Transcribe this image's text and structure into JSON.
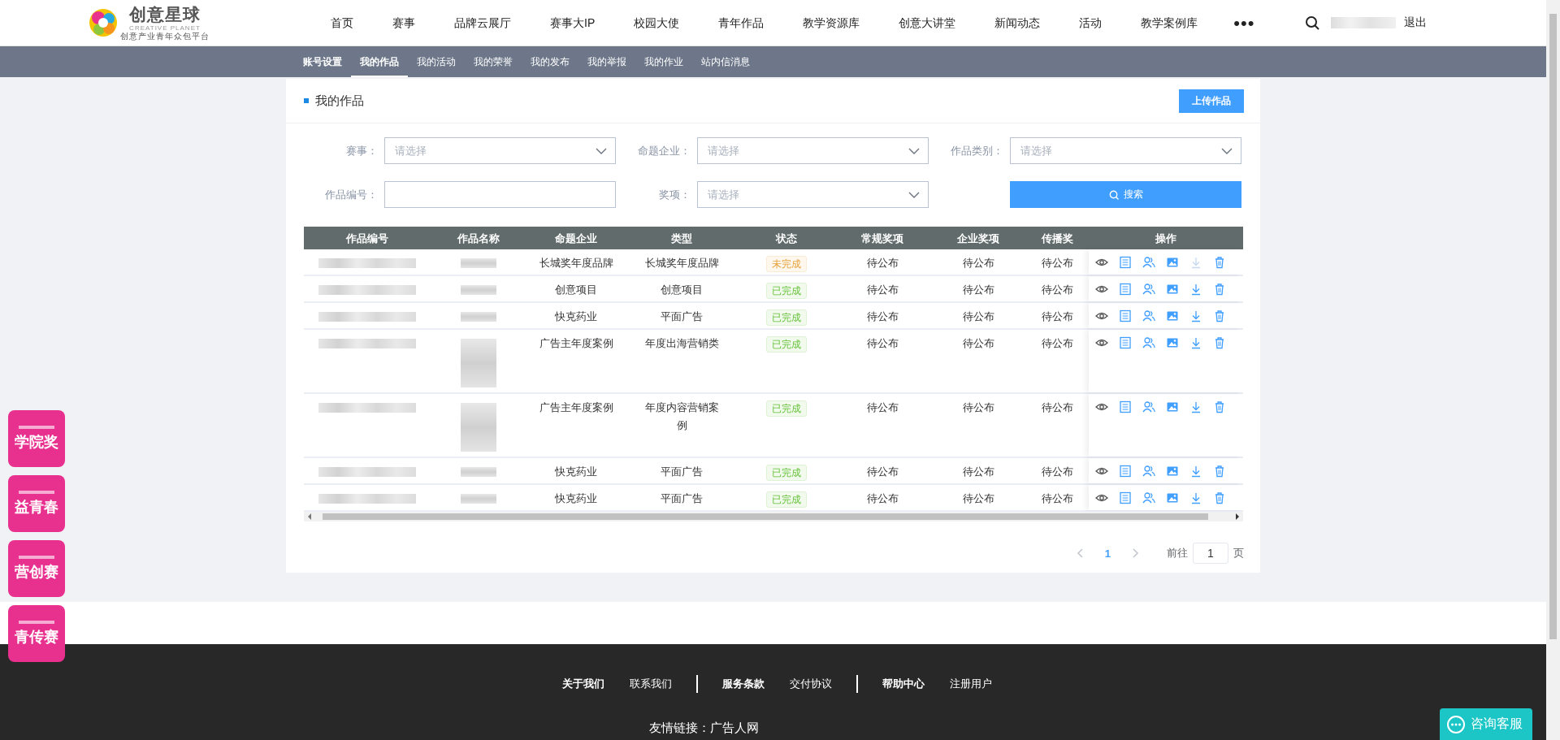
{
  "header": {
    "logo": {
      "name": "创意星球",
      "subtitle_en": "CREATIVE PLANET",
      "tagline": "创意产业青年众包平台"
    },
    "nav": [
      {
        "label": "首页"
      },
      {
        "label": "赛事"
      },
      {
        "label": "品牌云展厅"
      },
      {
        "label": "赛事大IP"
      },
      {
        "label": "校园大使"
      },
      {
        "label": "青年作品"
      },
      {
        "label": "教学资源库"
      },
      {
        "label": "创意大讲堂"
      },
      {
        "label": "新闻动态"
      },
      {
        "label": "活动"
      },
      {
        "label": "教学案例库"
      },
      {
        "label": "•••"
      }
    ],
    "logout": "退出"
  },
  "subnav": {
    "heading": "账号设置",
    "tabs": [
      {
        "label": "我的作品",
        "selected": true
      },
      {
        "label": "我的活动",
        "selected": false
      },
      {
        "label": "我的荣誉",
        "selected": false
      },
      {
        "label": "我的发布",
        "selected": false
      },
      {
        "label": "我的举报",
        "selected": false
      },
      {
        "label": "我的作业",
        "selected": false
      },
      {
        "label": "站内信消息",
        "selected": false
      }
    ]
  },
  "card": {
    "title": "我的作品",
    "upload_button": "上传作品",
    "search_button": "搜索",
    "filters": [
      {
        "label": "赛事：",
        "placeholder": "请选择",
        "kind": "select"
      },
      {
        "label": "命题企业：",
        "placeholder": "请选择",
        "kind": "select"
      },
      {
        "label": "作品类别：",
        "placeholder": "请选择",
        "kind": "select"
      },
      {
        "label": "作品编号：",
        "kind": "input"
      },
      {
        "label": "奖项：",
        "placeholder": "请选择",
        "kind": "select"
      }
    ]
  },
  "table": {
    "columns": [
      "作品编号",
      "作品名称",
      "命题企业",
      "类型",
      "状态",
      "常规奖项",
      "企业奖项",
      "传播奖",
      "操作"
    ],
    "rows": [
      {
        "company": "长城奖年度品牌",
        "type": "长城奖年度品牌",
        "status": {
          "text": "未完成",
          "color": "#e6a23c"
        },
        "regular_award": "待公布",
        "company_award": "待公布",
        "spread_award": "待公布",
        "download_enabled": false,
        "tall": false
      },
      {
        "company": "创意项目",
        "type": "创意项目",
        "status": {
          "text": "已完成",
          "color": "#67c23a"
        },
        "regular_award": "待公布",
        "company_award": "待公布",
        "spread_award": "待公布",
        "download_enabled": true,
        "tall": false
      },
      {
        "company": "快克药业",
        "type": "平面广告",
        "status": {
          "text": "已完成",
          "color": "#67c23a"
        },
        "regular_award": "待公布",
        "company_award": "待公布",
        "spread_award": "待公布",
        "download_enabled": true,
        "tall": false
      },
      {
        "company": "广告主年度案例",
        "type": "年度出海营销类",
        "status": {
          "text": "已完成",
          "color": "#67c23a"
        },
        "regular_award": "待公布",
        "company_award": "待公布",
        "spread_award": "待公布",
        "download_enabled": true,
        "tall": true
      },
      {
        "company": "广告主年度案例",
        "type": "年度内容营销案例",
        "status": {
          "text": "已完成",
          "color": "#67c23a"
        },
        "regular_award": "待公布",
        "company_award": "待公布",
        "spread_award": "待公布",
        "download_enabled": true,
        "tall": true
      },
      {
        "company": "快克药业",
        "type": "平面广告",
        "status": {
          "text": "已完成",
          "color": "#67c23a"
        },
        "regular_award": "待公布",
        "company_award": "待公布",
        "spread_award": "待公布",
        "download_enabled": true,
        "tall": false
      },
      {
        "company": "快克药业",
        "type": "平面广告",
        "status": {
          "text": "已完成",
          "color": "#67c23a"
        },
        "regular_award": "待公布",
        "company_award": "待公布",
        "spread_award": "待公布",
        "download_enabled": true,
        "tall": false
      }
    ]
  },
  "pagination": {
    "current_page": "1",
    "goto_label": "前往",
    "goto_value": "1",
    "page_unit": "页"
  },
  "side_badges": [
    {
      "text": "学院奖"
    },
    {
      "text": "益青春"
    },
    {
      "text": "营创赛"
    },
    {
      "text": "青传赛"
    }
  ],
  "footer": {
    "link_groups": [
      [
        {
          "label": "关于我们",
          "bold": true
        },
        {
          "label": "联系我们",
          "bold": false
        }
      ],
      [
        {
          "label": "服务条款",
          "bold": true
        },
        {
          "label": "交付协议",
          "bold": false
        }
      ],
      [
        {
          "label": "帮助中心",
          "bold": true
        },
        {
          "label": "注册用户",
          "bold": false
        }
      ]
    ],
    "friend_links": "友情链接：广告人网"
  },
  "chat_button": "咨询客服"
}
